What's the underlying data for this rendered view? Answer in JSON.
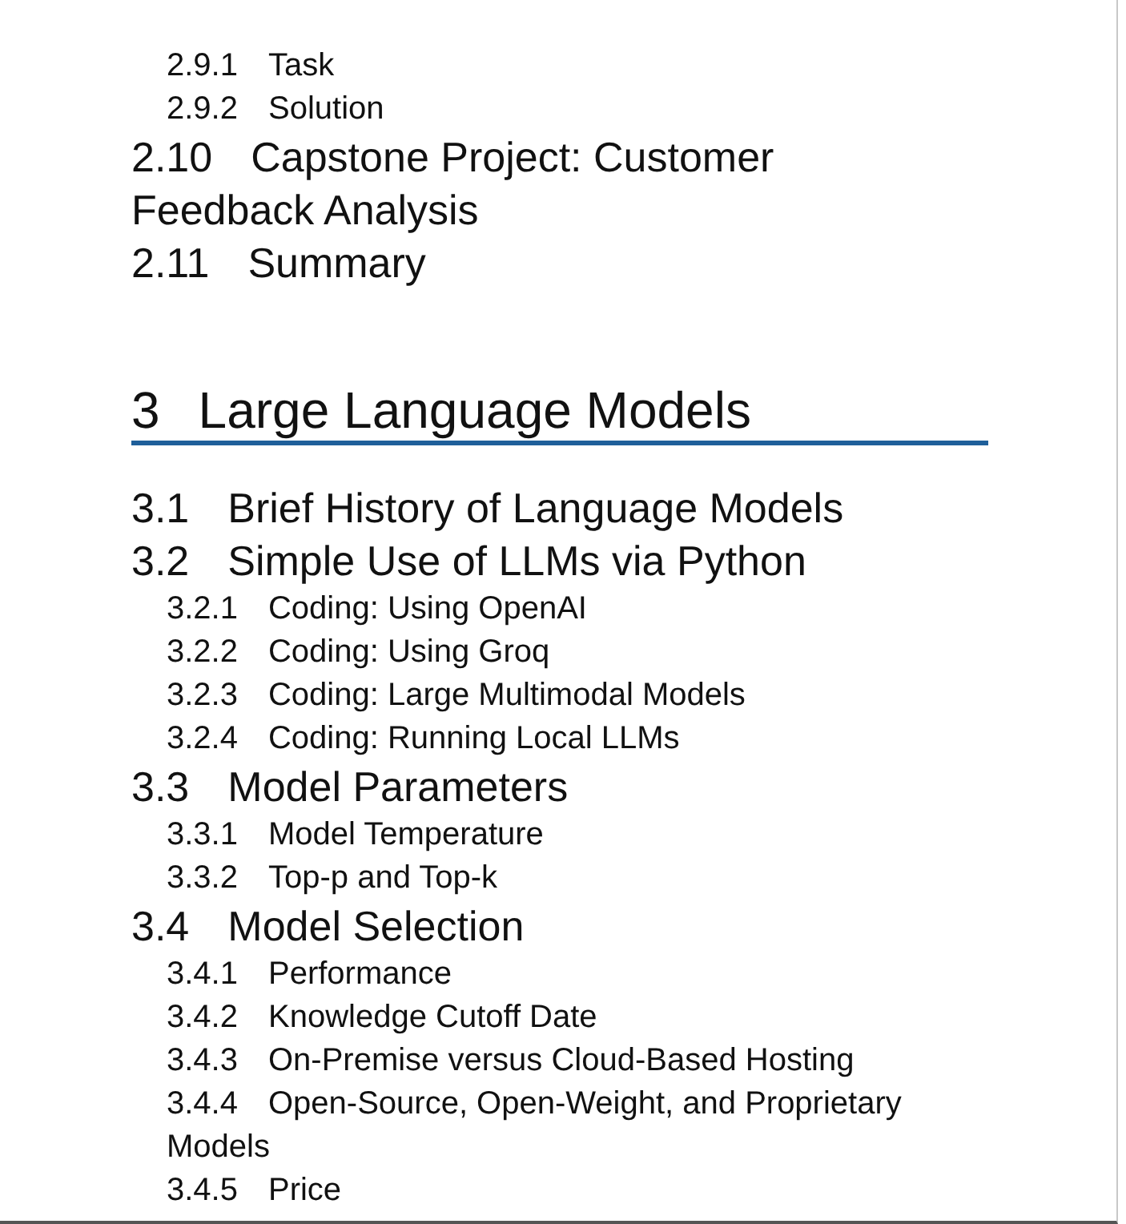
{
  "toc": [
    {
      "kind": "subsection",
      "number": "2.9.1",
      "title": "Task"
    },
    {
      "kind": "subsection",
      "number": "2.9.2",
      "title": "Solution"
    },
    {
      "kind": "section",
      "number": "2.10",
      "title": "Capstone Project: Customer Feedback Analysis"
    },
    {
      "kind": "section",
      "number": "2.11",
      "title": "Summary"
    },
    {
      "kind": "chapter",
      "number": "3",
      "title": "Large Language Models",
      "children": [
        {
          "kind": "section",
          "number": "3.1",
          "title": "Brief History of Language Models"
        },
        {
          "kind": "section",
          "number": "3.2",
          "title": "Simple Use of LLMs via Python",
          "children": [
            {
              "kind": "subsection",
              "number": "3.2.1",
              "title": "Coding: Using OpenAI"
            },
            {
              "kind": "subsection",
              "number": "3.2.2",
              "title": "Coding: Using Groq"
            },
            {
              "kind": "subsection",
              "number": "3.2.3",
              "title": "Coding: Large Multimodal Models"
            },
            {
              "kind": "subsection",
              "number": "3.2.4",
              "title": "Coding: Running Local LLMs"
            }
          ]
        },
        {
          "kind": "section",
          "number": "3.3",
          "title": "Model Parameters",
          "children": [
            {
              "kind": "subsection",
              "number": "3.3.1",
              "title": "Model Temperature"
            },
            {
              "kind": "subsection",
              "number": "3.3.2",
              "title": "Top-p and Top-k"
            }
          ]
        },
        {
          "kind": "section",
          "number": "3.4",
          "title": "Model Selection",
          "children": [
            {
              "kind": "subsection",
              "number": "3.4.1",
              "title": "Performance"
            },
            {
              "kind": "subsection",
              "number": "3.4.2",
              "title": "Knowledge Cutoff Date"
            },
            {
              "kind": "subsection",
              "number": "3.4.3",
              "title": "On-Premise versus Cloud-Based Hosting"
            },
            {
              "kind": "subsection",
              "number": "3.4.4",
              "title": "Open-Source, Open-Weight, and Proprietary Models"
            },
            {
              "kind": "subsection",
              "number": "3.4.5",
              "title": "Price"
            }
          ]
        }
      ]
    }
  ]
}
